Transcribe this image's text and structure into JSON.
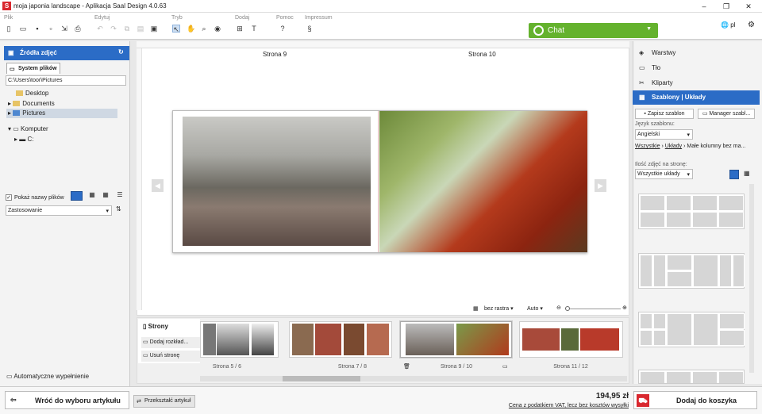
{
  "window": {
    "title": "moja japonia landscape - Aplikacja Saal Design 4.0.63"
  },
  "menu": {
    "plik": "Plik",
    "edytuj": "Edytuj",
    "tryb": "Tryb",
    "dodaj": "Dodaj",
    "pomoc": "Pomoc",
    "impressum": "Impressum",
    "help_glyph": "?",
    "impressum_glyph": "§"
  },
  "chat": {
    "label": "Chat"
  },
  "lang": {
    "code": "pl"
  },
  "left": {
    "header": "Źródła zdjęć",
    "tab": "System plików",
    "path": "C:\\Users\\toor\\Pictures",
    "tree": [
      "Desktop",
      "Documents",
      "Pictures",
      "Komputer",
      "C:"
    ],
    "show_names": "Pokaż nazwy plików",
    "usage": "Zastosowanie",
    "autofill": "Automatyczne wypełnienie"
  },
  "center": {
    "page_left": "Strona 9",
    "page_right": "Strona 10",
    "grid": "bez rastra",
    "zoom": "Auto"
  },
  "pages": {
    "title": "Strony",
    "add_spread": "Dodaj rozkład...",
    "remove_page": "Usuń stronę",
    "labels": [
      "Strona 5 / 6",
      "Strona 7 / 8",
      "Strona 9 / 10",
      "Strona 11 / 12"
    ]
  },
  "right": {
    "layers": "Warstwy",
    "background": "Tło",
    "cliparts": "Kliparty",
    "templates": "Szablony | Układy",
    "save_template": "Zapisz szablon",
    "manager": "Manager szabl...",
    "lang_label": "Język szablonu:",
    "lang_value": "Angielski",
    "crumb1": "Wszystkie",
    "crumb2": "Układy",
    "crumb3": "Małe kolumny bez ma...",
    "count_label": "Ilość zdjęć na stronę:",
    "count_value": "Wszystkie układy"
  },
  "bottom": {
    "back": "Wróć do wyboru artykułu",
    "convert": "Przekształć artykuł",
    "price": "194,95 zł",
    "price_note": "Cena z podatkiem VAT, lecz bez kosztów wysyłki",
    "cart": "Dodaj do koszyka"
  },
  "colors": {
    "accent": "#2b6cc6",
    "chat": "#64b22d",
    "brand": "#d9282f"
  }
}
